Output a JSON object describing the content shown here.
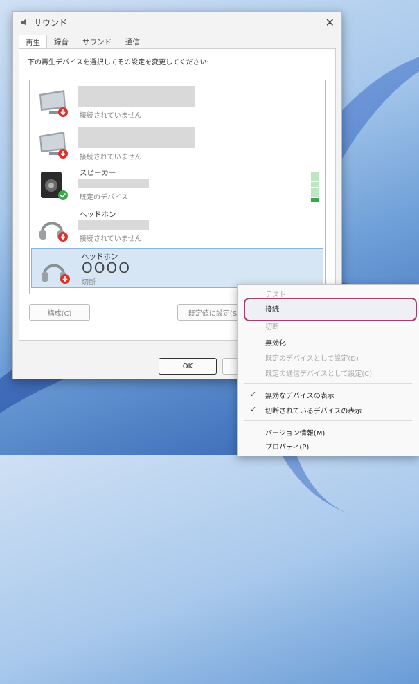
{
  "window": {
    "title": "サウンド",
    "close": "✕"
  },
  "tabs": [
    {
      "label": "再生"
    },
    {
      "label": "録音"
    },
    {
      "label": "サウンド"
    },
    {
      "label": "通信"
    }
  ],
  "instruction": "下の再生デバイスを選択してその設定を変更してください:",
  "devices": [
    {
      "name": "",
      "status": "接続されていません"
    },
    {
      "name": "",
      "status": "接続されていません"
    },
    {
      "name": "スピーカー",
      "status": "既定のデバイス"
    },
    {
      "name": "ヘッドホン",
      "status": "接続されていません"
    },
    {
      "name": "ヘッドホン",
      "model": "OOOO",
      "status": "切断"
    }
  ],
  "level_meter": {
    "level": 0.2
  },
  "buttons": {
    "configure": "構成(C)",
    "set_default": "既定値に設定(S)",
    "ok": "OK",
    "cancel": "キャン"
  },
  "context_menu": {
    "items": [
      {
        "label": "テスト",
        "enabled": false
      },
      {
        "label": "接続",
        "enabled": true,
        "highlighted": true
      },
      {
        "label": "切断",
        "enabled": false
      },
      {
        "label": "無効化",
        "enabled": true
      },
      {
        "label": "既定のデバイスとして設定(D)",
        "enabled": false
      },
      {
        "label": "既定の通信デバイスとして設定(C)",
        "enabled": false
      },
      {
        "label": "無効なデバイスの表示",
        "enabled": true,
        "checked": true
      },
      {
        "label": "切断されているデバイスの表示",
        "enabled": true,
        "checked": true
      },
      {
        "label": "バージョン情報(M)",
        "enabled": true
      },
      {
        "label": "プロパティ(P)",
        "enabled": true
      }
    ],
    "check_mark": "✓"
  },
  "colors": {
    "highlight_border": "#a3416b",
    "selected_row": "#d6e6f5",
    "level_green": "#3aa84a",
    "disconnected_badge": "#d9342b",
    "default_badge": "#3aa84a"
  }
}
